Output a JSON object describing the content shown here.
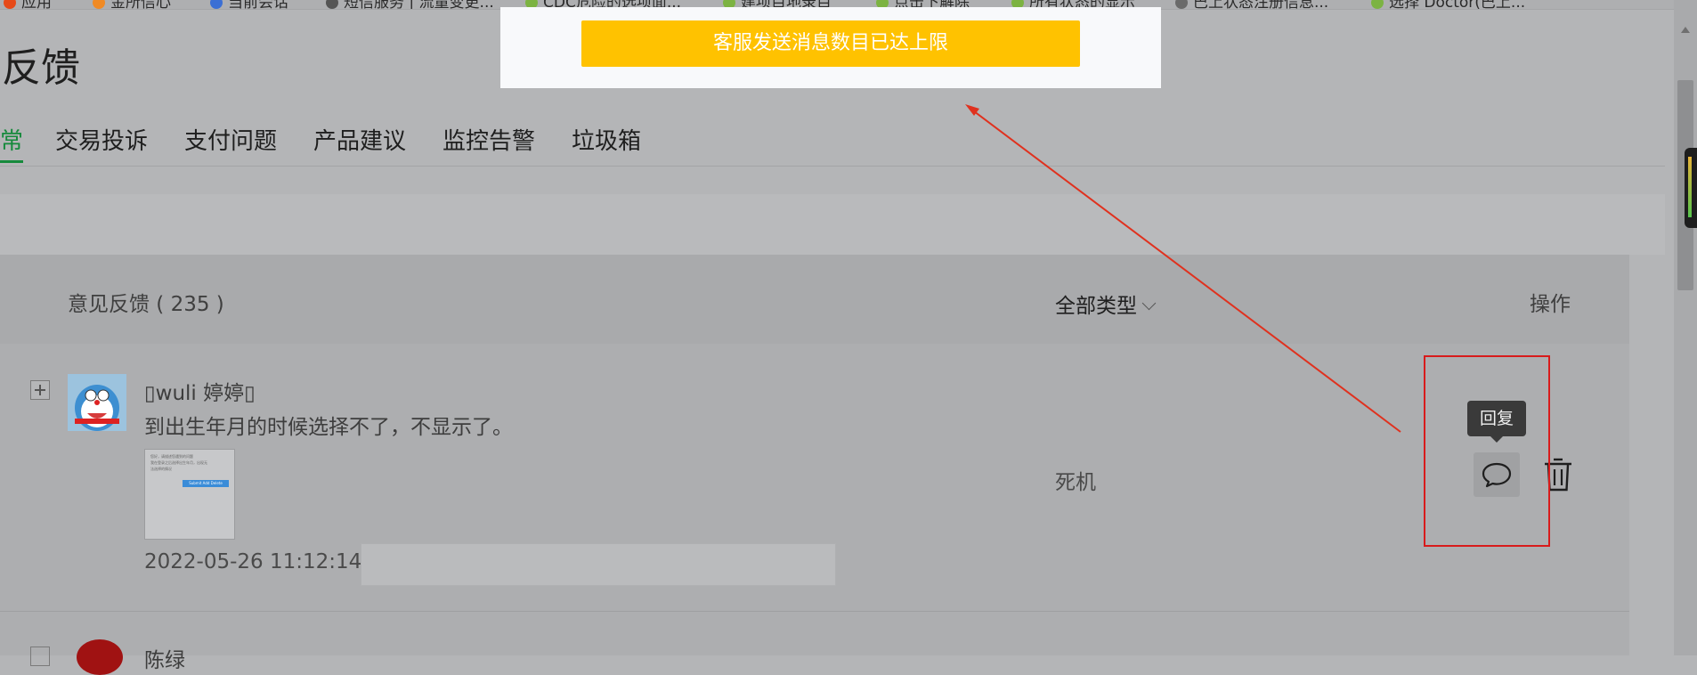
{
  "bookmarks": [
    {
      "label": "应用",
      "color": "#e64a19"
    },
    {
      "label": "金所信心",
      "color": "#f08a24"
    },
    {
      "label": "当前会话",
      "color": "#3b6fd4"
    },
    {
      "label": "短信服务 | 流量变更...",
      "color": "#555555"
    },
    {
      "label": "CDC危险的选项面...",
      "color": "#7cb342"
    },
    {
      "label": "建项目地录目",
      "color": "#7cb342"
    },
    {
      "label": "点击下解除",
      "color": "#7cb342"
    },
    {
      "label": "所有状态的显示",
      "color": "#7cb342"
    },
    {
      "label": "巴上状态注册信息...",
      "color": "#6a6a6a"
    },
    {
      "label": "选择 Doctor(巴上...",
      "color": "#7cb342"
    }
  ],
  "page": {
    "title": "反馈"
  },
  "tabs": [
    {
      "label": "常",
      "active": true
    },
    {
      "label": "交易投诉",
      "active": false
    },
    {
      "label": "支付问题",
      "active": false
    },
    {
      "label": "产品建议",
      "active": false
    },
    {
      "label": "监控告警",
      "active": false
    },
    {
      "label": "垃圾箱",
      "active": false
    }
  ],
  "table": {
    "title": "意见反馈 ( 235 )",
    "type_filter": "全部类型",
    "ops_header": "操作"
  },
  "row1": {
    "username": "▯wuli 婷婷▯",
    "message": "到出生年月的时候选择不了，不显示了。",
    "time": "2022-05-26 11:12:14",
    "type": "死机"
  },
  "thumb": {
    "line1": "您好，请描述您遇到的问题",
    "line2": "我在登录之后选择出生年月，出现无",
    "line3": "法选择的情况",
    "btn": "Submit  Add  Delete"
  },
  "row2": {
    "username": "陈绿"
  },
  "tooltip": {
    "reply": "回复"
  },
  "toast": {
    "message": "客服发送消息数目已达上限"
  },
  "colors": {
    "accent": "#168a3c",
    "toast": "#ffc200",
    "annotation": "#d81b1b"
  }
}
